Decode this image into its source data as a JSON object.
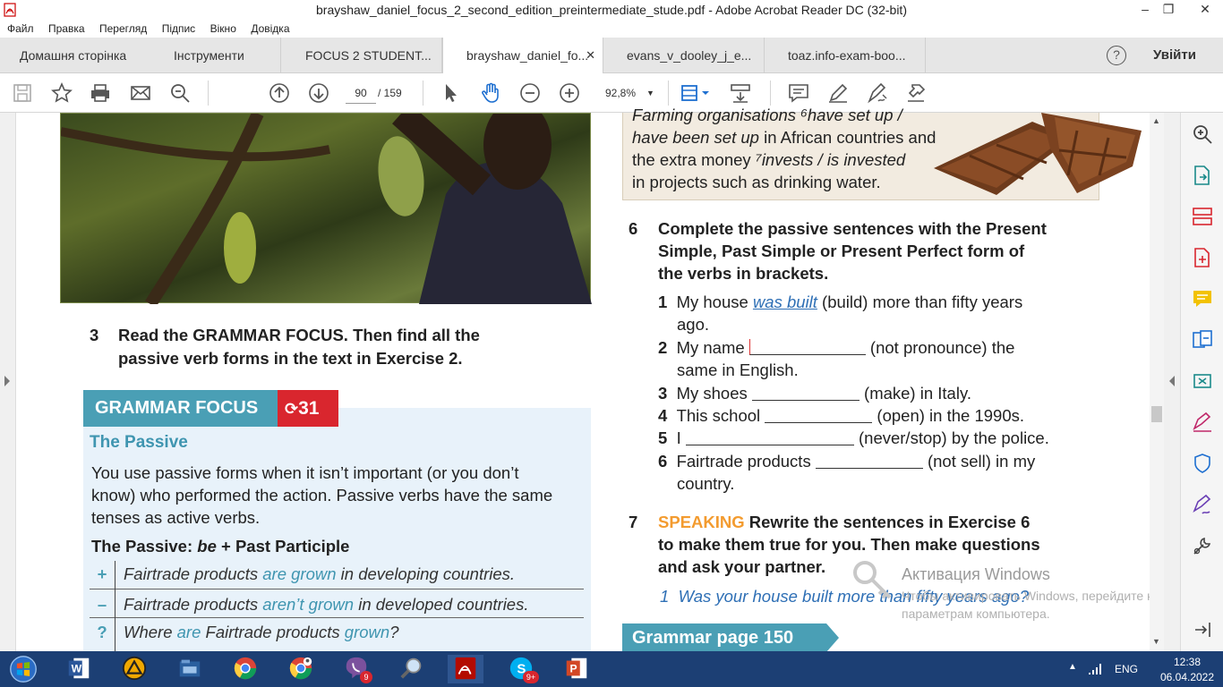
{
  "window": {
    "title": "brayshaw_daniel_focus_2_second_edition_preintermediate_stude.pdf - Adobe Acrobat Reader DC (32-bit)",
    "minimize": "–",
    "maximize": "❐",
    "close": "✕"
  },
  "menu": [
    "Файл",
    "Правка",
    "Перегляд",
    "Підпис",
    "Вікно",
    "Довідка"
  ],
  "tabs": {
    "home": "Домашня сторінка",
    "tools": "Інструменти",
    "doc1": "FOCUS 2 STUDENT...",
    "doc2": "brayshaw_daniel_fo...",
    "doc2_close": "✕",
    "doc3": "evans_v_dooley_j_e...",
    "doc4": "toaz.info-exam-boo...",
    "help": "?",
    "login": "Увійти"
  },
  "toolbar": {
    "page_current": "90",
    "page_total": "/ 159",
    "zoom": "92,8%"
  },
  "document": {
    "ex3": {
      "num": "3",
      "line1": "Read the GRAMMAR FOCUS. Then find all the",
      "line2": "passive verb forms in the text in Exercise 2."
    },
    "grammar_focus": {
      "label": "GRAMMAR FOCUS",
      "num": "31",
      "title": "The Passive",
      "desc1": "You use passive forms when it isn’t important (or you don’t",
      "desc2": "know) who performed the action. Passive verbs have the same",
      "desc3": "tenses as active verbs.",
      "formula_a": "The Passive: ",
      "formula_b": "be",
      "formula_c": " + Past Participle",
      "rows": [
        {
          "sym": "+",
          "a": "Fairtrade products ",
          "b": "are grown",
          "c": " in developing countries."
        },
        {
          "sym": "–",
          "a": "Fairtrade products ",
          "b": "aren’t grown",
          "c": " in developed countries."
        },
        {
          "sym": "?",
          "a": "Where ",
          "b": "are",
          "c": " Fairtrade products ",
          "d": "grown",
          "e": "?"
        }
      ]
    },
    "fairtrade": {
      "l1": "Farming organisations ⁶have set up /",
      "l2a": "have been set up",
      "l2b": " in African countries and",
      "l3a": "the extra money ",
      "l3b": "⁷invests / is invested",
      "l4": "in projects such as drinking water."
    },
    "ex6": {
      "num": "6",
      "line1": "Complete the passive sentences with the Present",
      "line2": "Simple, Past Simple or Present Perfect form of",
      "line3": "the verbs in brackets.",
      "items": [
        {
          "n": "1",
          "a": "My house ",
          "ans": "was built",
          "b": " (build) more than fifty years",
          "c": "ago."
        },
        {
          "n": "2",
          "a": "My name ",
          "b": " (not pronounce) the",
          "c": "same in English."
        },
        {
          "n": "3",
          "a": "My shoes ",
          "b": " (make) in Italy."
        },
        {
          "n": "4",
          "a": "This school ",
          "b": " (open) in the 1990s."
        },
        {
          "n": "5",
          "a": "I ",
          "b": " (never/stop) by the police."
        },
        {
          "n": "6",
          "a": "Fairtrade products ",
          "b": " (not sell) in my",
          "c": "country."
        }
      ]
    },
    "ex7": {
      "num": "7",
      "speaking": "SPEAKING",
      "line1": " Rewrite the sentences in Exercise 6",
      "line2": "to make them true for you. Then make questions",
      "line3": "and ask your partner.",
      "example_n": "1",
      "example": "Was your house built more than fifty years ago?"
    },
    "grammar_page": "Grammar page 150"
  },
  "watermark": {
    "title": "Активация Windows",
    "line1": "Чтобы активировать Windows, перейдите к",
    "line2": "параметрам компьютера."
  },
  "taskbar": {
    "lang": "ENG",
    "time": "12:38",
    "date": "06.04.2022",
    "badge_viber": "9",
    "badge_skype": "9+"
  }
}
